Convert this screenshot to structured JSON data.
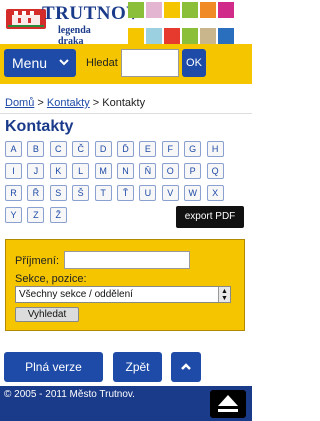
{
  "header": {
    "logo_text": "TRUTNOV",
    "logo_subtitle": "legenda draka",
    "logo_red_color": "#d42b2b",
    "brand_blue": "#1a3a8a",
    "squares": [
      {
        "color": "#8bbf3a"
      },
      {
        "color": "#e3b5d0"
      },
      {
        "color": "#f5c500"
      },
      {
        "color": "#8bbf3a"
      },
      {
        "color": "#f08a24"
      },
      {
        "color": "#d12b8a"
      },
      {
        "color": "#f5c500"
      },
      {
        "color": "#9ad0e0"
      },
      {
        "color": "#e63a2e"
      },
      {
        "color": "#8bbf3a"
      },
      {
        "color": "#c9b68c"
      },
      {
        "color": "#2a6fbd"
      }
    ]
  },
  "searchbar": {
    "menu_label": "Menu",
    "search_label": "Hledat",
    "search_value": "",
    "ok_label": "OK",
    "bg_color": "#f5c500",
    "button_color": "#1e4aa8"
  },
  "breadcrumb": {
    "items": [
      "Domů",
      "Kontakty",
      "Kontakty"
    ],
    "separator": ">"
  },
  "page_title": "Kontakty",
  "alphabet": {
    "rows": [
      [
        "A",
        "B",
        "C",
        "Č",
        "D",
        "Ď",
        "E",
        "F",
        "G",
        "H"
      ],
      [
        "I",
        "J",
        "K",
        "L",
        "M",
        "N",
        "Ň",
        "O",
        "P",
        "Q"
      ],
      [
        "R",
        "Ř",
        "S",
        "Š",
        "T",
        "Ť",
        "U",
        "V",
        "W",
        "X"
      ],
      [
        "Y",
        "Z",
        "Ž"
      ]
    ]
  },
  "export_label": "export PDF",
  "form": {
    "prijmeni_label": "Příjmení:",
    "prijmeni_value": "",
    "sekce_label": "Sekce, pozice:",
    "sekce_selected": "Všechny sekce  / oddělení",
    "submit_label": "Vyhledat"
  },
  "bottom_nav": {
    "full_label": "Plná verze",
    "back_label": "Zpět"
  },
  "footer": {
    "text": "© 2005 - 2011 Město Trutnov."
  }
}
